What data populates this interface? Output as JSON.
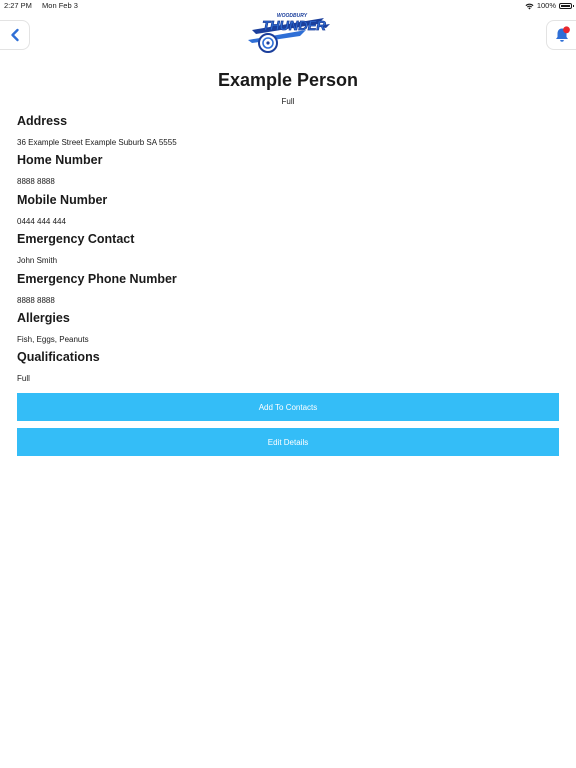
{
  "status": {
    "time": "2:27 PM",
    "date": "Mon Feb 3",
    "battery": "100%"
  },
  "header": {
    "back_icon": "chevron-left-icon",
    "bell_icon": "bell-icon",
    "logo_text_top": "WOODBURY",
    "logo_text_main": "THUNDER",
    "accent_color": "#2f6fd6",
    "badge_color": "#e8262c"
  },
  "person": {
    "name": "Example Person",
    "subtitle": "Full"
  },
  "fields": [
    {
      "label": "Address",
      "value": "36 Example Street Example Suburb SA 5555"
    },
    {
      "label": "Home Number",
      "value": "8888 8888"
    },
    {
      "label": "Mobile Number",
      "value": "0444 444 444"
    },
    {
      "label": "Emergency Contact",
      "value": "John Smith"
    },
    {
      "label": "Emergency Phone Number",
      "value": "8888 8888"
    },
    {
      "label": "Allergies",
      "value": "Fish, Eggs, Peanuts"
    },
    {
      "label": "Qualifications",
      "value": "Full"
    }
  ],
  "actions": {
    "add_contacts": "Add To Contacts",
    "edit_details": "Edit Details",
    "button_color": "#34bdf7"
  }
}
